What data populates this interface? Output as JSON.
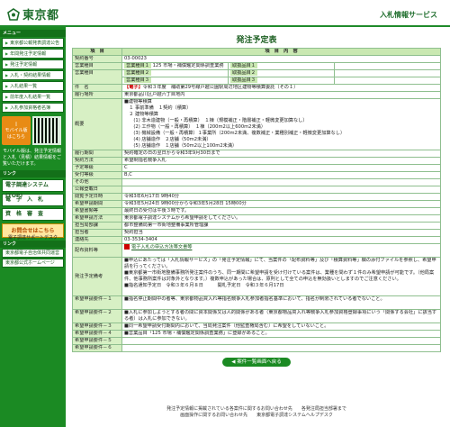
{
  "header": {
    "logo": "東京都",
    "service": "入札情報サービス"
  },
  "sidebar": {
    "menu_head": "メニュー",
    "menu": [
      "東京都公報発表調達公告",
      "年間発注予定情報",
      "発注予定情報",
      "入札・契約結果情報",
      "入札結果一覧",
      "前年度入札結果一覧",
      "入札参加資格者名簿",
      "入札参加資格者名簿"
    ],
    "mobile_title": "モバイル版",
    "mobile_sub": "はこちら",
    "mobile_note": "モバイル版は、発注予定情報と入札（見積）結果情報をご覧いただけます。",
    "links_head": "リンク",
    "big_buttons": [
      "電子調達システム(TOP)",
      "電　子　入　札",
      "資　格　審　査"
    ],
    "contact_title": "お問合せはこちら",
    "contact_sub": "電子調達サポートデスク",
    "links2_head": "リンク",
    "links2": [
      "東京都電子自治体共同運営",
      "東京都公式ホームページ"
    ]
  },
  "page": {
    "title": "発注予定表"
  },
  "table": {
    "h1": "項　目",
    "h2": "項　目　内　容",
    "contract_no_label": "契約番号",
    "contract_no": "03-00023",
    "biz1_label": "営業種目",
    "biz1_tag": "営業種目１",
    "biz1_val": "125 市場・補償鑑定関係調査業務",
    "sub1_tag": "取扱品目１",
    "biz2_label": "営業種目",
    "biz2_tag": "営業種目２",
    "sub2_tag": "取扱品目２",
    "biz3_tag": "営業種目３",
    "sub3_tag": "取扱品目３",
    "name_label": "件　名",
    "name_prefix": "【電子】",
    "name_val": "令和３年度　補助第29号線戸越公園駅周辺地区建物等積算委託（その１）",
    "place_label": "履行場所",
    "place_val": "東京都品川区戸越六丁目地内",
    "summary_label": "概要",
    "summary": [
      "■建物等積算",
      "　１ 事前準備　１契約（積算）",
      "　２ 建物等積算",
      "　　(1) 非木造建物（一般・再積算）　１棟（規模補正・階層補正・軽微変更加算なし）",
      "　　(2) 工作物（一般・再積算）　１棟（200m2以上600m2未満）",
      "　　(3) 機械設備（一般・再積算）１事業所（200m2未満、複数補正・業種別補正・軽微変更加算なし）",
      "　　(4) 店舗造作　２店舗（50m2未満）",
      "　　(5) 店舗造作　１店舗（50m2以上100m2未満）"
    ],
    "term_label": "履行期間",
    "term_val": "契約確定の日の翌日から令和3年9月30日まで",
    "method_label": "契約方法",
    "method_val": "希望制指名競争入札",
    "grade_label": "予定等級",
    "grade_val": "C",
    "grade2_label": "受付等級",
    "grade2_val": "B,C",
    "other_label": "その他",
    "other_val": "",
    "date_label": "公報登載日",
    "date_val": "",
    "pub_label": "閲覧予定日時",
    "pub_val": "令和3年6月17日 9時40分",
    "app_label": "希望申請期間",
    "app_val": "令和3年5月24日 9時00分から令和3年5月28日 15時00分",
    "sub_label": "希望書類等",
    "sub_val": "最終日の受付は午後３時です。",
    "way_label": "希望申請方法",
    "way_val": "東京都電子調達システムから希望申請をしてください。",
    "dept_label": "担当局部課",
    "dept_val": "都市整備局第一市街地整備事業所管理課",
    "person_label": "担当者",
    "person_val": "契約担当",
    "tel_label": "連絡先",
    "tel_val": "03-3534-3404",
    "doc_label": "配布資料等",
    "doc_val": "電子入札の申込方法等文書等",
    "notice_label": "発注予定備考",
    "notice": [
      "■申込にあたっては「入札情報サービス」の「発注予定情報」にて、当案件の「配布資料等」及び「積算資料等」欄の添付ファイルを参照し、希望申請を行ってください。",
      "■東京都第一市街地整備事務所発注案件のうち、同一期間に希望申請を受け付けている案件は、業種を問わず１件のみ希望申請が可能です。（他局案件、他事務所案件は対象外となります。）複数申込があった場合は、原則として全ての申込を無効扱いとしますのでご注意ください。",
      "■指名通知予定日　令和３年６月８日　　　開札予定日　令和３年６月17日"
    ],
    "req1_label": "希望申請要件－１",
    "req1_val": "■指名停止期間中の者等、東京都物品買入れ等指名競争入札参加者指名基準において、指名が制限されている者でないこと。",
    "req2_label": "希望申請要件－２",
    "req2_val": "■入札に参加しようとする者の間に資本関係又は人的関係がある者（東京都物品買入れ等競争入札参加資格登録事項にいう「関係する会社」に該当する者）は入札に参加できない。",
    "req3_label": "希望申請要件－３",
    "req3_val": "■同一希望申請受付期間内において、当局発注案件（他監査権局含む）に希望をしていないこと。",
    "req4_label": "希望申請要件－４",
    "req4_val": "■営業品目「125 市場・補償鑑定関係調査業務」に登録があること。",
    "req5_label": "希望申請要件－５",
    "req6_label": "希望申請要件－６"
  },
  "back_button": "案件一覧画面へ戻る",
  "footer": [
    "発注予定情報に掲載されている各案件に関するお問い合わせ先　　各発注局担当部署まで",
    "画面操作に関するお問い合わせ先　　東京都電子調達システムヘルプデスク"
  ]
}
